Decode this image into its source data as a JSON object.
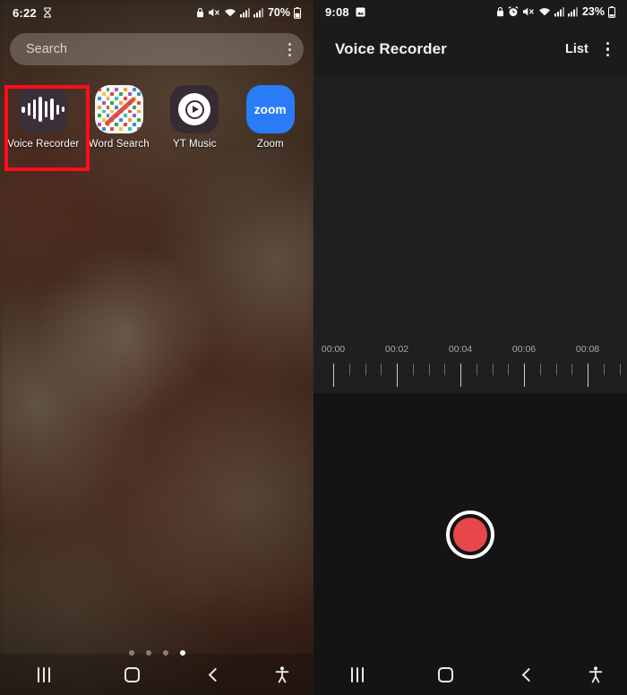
{
  "left_screen": {
    "status_bar": {
      "time": "6:22",
      "time_icon": "hourglass-icon",
      "icons": [
        "lock-icon",
        "mute-icon",
        "wifi-icon",
        "signal-icon",
        "signal-icon"
      ],
      "battery_percent": "70%",
      "battery_icon": "battery-icon"
    },
    "search": {
      "placeholder": "Search",
      "menu_icon": "kebab-menu-icon"
    },
    "apps": [
      {
        "label": "Voice Recorder",
        "icon": "voice-recorder-icon",
        "highlighted": true
      },
      {
        "label": "Word Search",
        "icon": "word-search-icon",
        "highlighted": false
      },
      {
        "label": "YT Music",
        "icon": "yt-music-icon",
        "highlighted": false
      },
      {
        "label": "Zoom",
        "icon": "zoom-icon",
        "highlighted": false
      }
    ],
    "zoom_icon_text": "zoom",
    "page_indicator": {
      "count": 4,
      "active_index": 3
    },
    "nav_bar": {
      "recents": "recents-icon",
      "home": "home-icon",
      "back": "back-icon",
      "accessibility": "accessibility-icon"
    }
  },
  "right_screen": {
    "status_bar": {
      "time": "9:08",
      "time_icon": "image-icon",
      "icons": [
        "lock-icon",
        "alarm-icon",
        "mute-icon",
        "wifi-icon",
        "signal-icon",
        "signal-icon"
      ],
      "battery_percent": "23%",
      "battery_icon": "battery-icon"
    },
    "header": {
      "title": "Voice Recorder",
      "list_label": "List",
      "menu_icon": "kebab-menu-icon"
    },
    "timeline": {
      "labels": [
        "00:00",
        "00:02",
        "00:04",
        "00:06",
        "00:08"
      ],
      "major_tick_count": 5,
      "minor_ticks_between": 3
    },
    "record_button": {
      "name": "record-button",
      "ring_color": "#ffffff",
      "fill_color": "#e8474a"
    },
    "nav_bar": {
      "recents": "recents-icon",
      "home": "home-icon",
      "back": "back-icon",
      "accessibility": "accessibility-icon"
    }
  },
  "colors": {
    "highlight_box": "#fc0d1b",
    "record_red": "#e8474a",
    "zoom_blue": "#2a7cf6",
    "app_dark": "#1b1b1b",
    "wave_panel": "#1f1f1f"
  }
}
